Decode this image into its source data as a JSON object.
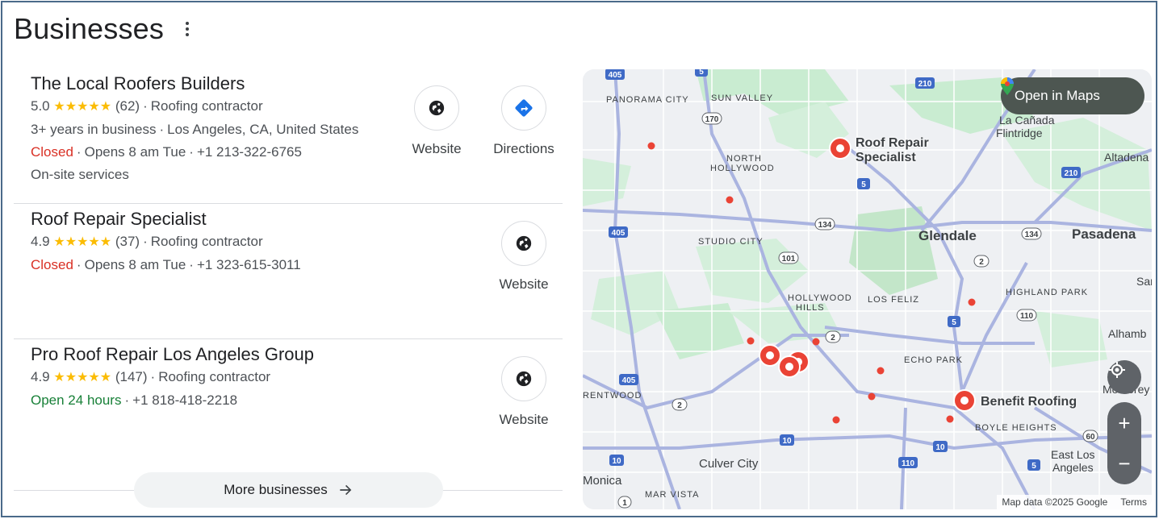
{
  "header": {
    "title": "Businesses"
  },
  "businesses": [
    {
      "name": "The Local Roofers Builders",
      "rating": "5.0",
      "stars": "★★★★★",
      "reviews": "(62)",
      "category": "Roofing contractor",
      "detail": "3+ years in business",
      "location": "Los Angeles, CA, United States",
      "status": "Closed",
      "hours": "Opens 8 am Tue",
      "phone": "+1 213-322-6765",
      "extra": "On-site services",
      "website_label": "Website",
      "directions_label": "Directions"
    },
    {
      "name": "Roof Repair Specialist",
      "rating": "4.9",
      "stars": "★★★★★",
      "reviews": "(37)",
      "category": "Roofing contractor",
      "status": "Closed",
      "hours": "Opens 8 am Tue",
      "phone": "+1 323-615-3011",
      "website_label": "Website"
    },
    {
      "name": "Pro Roof Repair Los Angeles Group",
      "rating": "4.9",
      "stars": "★★★★★",
      "reviews": "(147)",
      "category": "Roofing contractor",
      "status": "Open 24 hours",
      "phone": "+1 818-418-2218",
      "website_label": "Website"
    }
  ],
  "more_button": "More businesses",
  "map": {
    "open_in_maps": "Open in Maps",
    "pins": [
      "Roof Repair Specialist",
      "Benefit Roofing"
    ],
    "pin_lines": {
      "roof_repair": [
        "Roof Repair",
        "Specialist"
      ]
    },
    "neighborhoods": [
      "PANORAMA CITY",
      "SUN VALLEY",
      "NORTH",
      "HOLLYWOOD",
      "STUDIO CITY",
      "HOLLYWOOD",
      "HILLS",
      "LOS FELIZ",
      "ECHO PARK",
      "HIGHLAND PARK",
      "BOYLE HEIGHTS",
      "MAR VISTA",
      "RENTWOOD"
    ],
    "cities": [
      "Glendale",
      "Pasadena"
    ],
    "towns": [
      "La Cañada",
      "Flintridge",
      "Altadena",
      "Alhamb",
      "Monterey",
      "Culver City",
      "Monica",
      "East Los",
      "Angeles",
      "San"
    ],
    "shields": [
      "405",
      "5",
      "210",
      "170",
      "5",
      "134",
      "405",
      "101",
      "2",
      "134",
      "2",
      "110",
      "5",
      "2",
      "405",
      "2",
      "10",
      "10",
      "110",
      "10",
      "60",
      "5",
      "10",
      "1",
      "210"
    ],
    "attribution": "Map data ©2025 Google",
    "terms": "Terms",
    "zoom_in": "+",
    "zoom_out": "−",
    "colors": {
      "pin": "#ea4335",
      "park": "#c9ecd1",
      "road": "#aab4e0",
      "land": "#eef0f3"
    }
  }
}
